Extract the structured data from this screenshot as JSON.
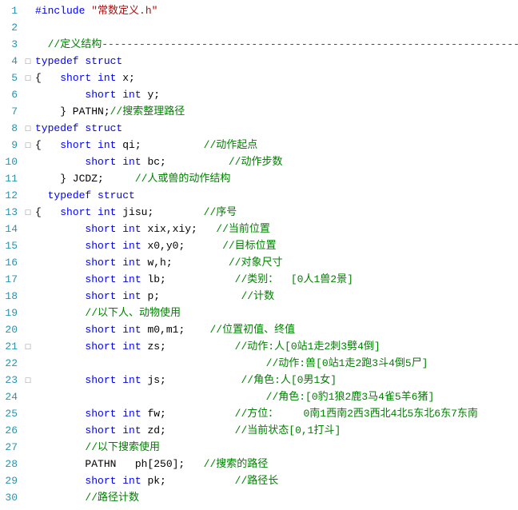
{
  "lines": [
    {
      "num": 1,
      "fold": "",
      "content": [
        {
          "type": "preproc",
          "text": "#include "
        },
        {
          "type": "string",
          "text": "\"常数定义.h\""
        }
      ]
    },
    {
      "num": 2,
      "fold": "",
      "content": []
    },
    {
      "num": 3,
      "fold": "",
      "content": [
        {
          "type": "comment",
          "text": "  //定义结构------------------------------------------------------------------------"
        }
      ]
    },
    {
      "num": 4,
      "fold": "□",
      "content": [
        {
          "type": "kw",
          "text": "typedef struct"
        }
      ]
    },
    {
      "num": 5,
      "fold": "□",
      "content": [
        {
          "type": "black",
          "text": "{   "
        },
        {
          "type": "kw",
          "text": "short int"
        },
        {
          "type": "black",
          "text": " x;"
        }
      ]
    },
    {
      "num": 6,
      "fold": "",
      "content": [
        {
          "type": "black",
          "text": "        "
        },
        {
          "type": "kw",
          "text": "short int"
        },
        {
          "type": "black",
          "text": " y;"
        }
      ]
    },
    {
      "num": 7,
      "fold": "",
      "content": [
        {
          "type": "black",
          "text": "    } PATHN;"
        },
        {
          "type": "comment",
          "text": "//搜索整理路径"
        }
      ]
    },
    {
      "num": 8,
      "fold": "□",
      "content": [
        {
          "type": "kw",
          "text": "typedef struct"
        }
      ]
    },
    {
      "num": 9,
      "fold": "□",
      "content": [
        {
          "type": "black",
          "text": "{   "
        },
        {
          "type": "kw",
          "text": "short int"
        },
        {
          "type": "black",
          "text": " qi;          "
        },
        {
          "type": "comment",
          "text": "//动作起点"
        }
      ]
    },
    {
      "num": 10,
      "fold": "",
      "content": [
        {
          "type": "black",
          "text": "        "
        },
        {
          "type": "kw",
          "text": "short int"
        },
        {
          "type": "black",
          "text": " bc;          "
        },
        {
          "type": "comment",
          "text": "//动作步数"
        }
      ]
    },
    {
      "num": 11,
      "fold": "",
      "content": [
        {
          "type": "black",
          "text": "    } JCDZ;     "
        },
        {
          "type": "comment",
          "text": "//人或兽的动作结构"
        }
      ]
    },
    {
      "num": 12,
      "fold": "",
      "content": [
        {
          "type": "black",
          "text": "  "
        },
        {
          "type": "kw",
          "text": "typedef struct"
        }
      ]
    },
    {
      "num": 13,
      "fold": "□",
      "content": [
        {
          "type": "black",
          "text": "{   "
        },
        {
          "type": "kw",
          "text": "short int"
        },
        {
          "type": "black",
          "text": " jisu;        "
        },
        {
          "type": "comment",
          "text": "//序号"
        }
      ]
    },
    {
      "num": 14,
      "fold": "",
      "content": [
        {
          "type": "black",
          "text": "        "
        },
        {
          "type": "kw",
          "text": "short int"
        },
        {
          "type": "black",
          "text": " xix,xiy;   "
        },
        {
          "type": "comment",
          "text": "//当前位置"
        }
      ]
    },
    {
      "num": 15,
      "fold": "",
      "content": [
        {
          "type": "black",
          "text": "        "
        },
        {
          "type": "kw",
          "text": "short int"
        },
        {
          "type": "black",
          "text": " x0,y0;      "
        },
        {
          "type": "comment",
          "text": "//目标位置"
        }
      ]
    },
    {
      "num": 16,
      "fold": "",
      "content": [
        {
          "type": "black",
          "text": "        "
        },
        {
          "type": "kw",
          "text": "short int"
        },
        {
          "type": "black",
          "text": " w,h;         "
        },
        {
          "type": "comment",
          "text": "//对象尺寸"
        }
      ]
    },
    {
      "num": 17,
      "fold": "",
      "content": [
        {
          "type": "black",
          "text": "        "
        },
        {
          "type": "kw",
          "text": "short int"
        },
        {
          "type": "black",
          "text": " lb;           "
        },
        {
          "type": "comment",
          "text": "//类别：  [0人1兽2景]"
        }
      ]
    },
    {
      "num": 18,
      "fold": "",
      "content": [
        {
          "type": "black",
          "text": "        "
        },
        {
          "type": "kw",
          "text": "short int"
        },
        {
          "type": "black",
          "text": " p;             "
        },
        {
          "type": "comment",
          "text": "//计数"
        }
      ]
    },
    {
      "num": 19,
      "fold": "",
      "content": [
        {
          "type": "black",
          "text": "        "
        },
        {
          "type": "comment",
          "text": "//以下人、动物使用"
        }
      ]
    },
    {
      "num": 20,
      "fold": "",
      "content": [
        {
          "type": "black",
          "text": "        "
        },
        {
          "type": "kw",
          "text": "short int"
        },
        {
          "type": "black",
          "text": " m0,m1;    "
        },
        {
          "type": "comment",
          "text": "//位置初值、终值"
        }
      ]
    },
    {
      "num": 21,
      "fold": "□",
      "content": [
        {
          "type": "black",
          "text": "        "
        },
        {
          "type": "kw",
          "text": "short int"
        },
        {
          "type": "black",
          "text": " zs;           "
        },
        {
          "type": "comment",
          "text": "//动作:人[0站1走2刺3劈4倒]"
        }
      ]
    },
    {
      "num": 22,
      "fold": "",
      "content": [
        {
          "type": "black",
          "text": "                                     "
        },
        {
          "type": "comment",
          "text": "//动作:兽[0站1走2跑3斗4倒5尸]"
        }
      ]
    },
    {
      "num": 23,
      "fold": "□",
      "content": [
        {
          "type": "black",
          "text": "        "
        },
        {
          "type": "kw",
          "text": "short int"
        },
        {
          "type": "black",
          "text": " js;            "
        },
        {
          "type": "comment",
          "text": "//角色:人[0男1女]"
        }
      ]
    },
    {
      "num": 24,
      "fold": "",
      "content": [
        {
          "type": "black",
          "text": "                                     "
        },
        {
          "type": "comment",
          "text": "//角色:[0豹1狼2鹿3马4雀5羊6猪]"
        }
      ]
    },
    {
      "num": 25,
      "fold": "",
      "content": [
        {
          "type": "black",
          "text": "        "
        },
        {
          "type": "kw",
          "text": "short int"
        },
        {
          "type": "black",
          "text": " fw;           "
        },
        {
          "type": "comment",
          "text": "//方位：    0南1西南2西3西北4北5东北6东7东南"
        }
      ]
    },
    {
      "num": 26,
      "fold": "",
      "content": [
        {
          "type": "black",
          "text": "        "
        },
        {
          "type": "kw",
          "text": "short int"
        },
        {
          "type": "black",
          "text": " zd;           "
        },
        {
          "type": "comment",
          "text": "//当前状态[0,1打斗]"
        }
      ]
    },
    {
      "num": 27,
      "fold": "",
      "content": [
        {
          "type": "black",
          "text": "        "
        },
        {
          "type": "comment",
          "text": "//以下搜索使用"
        }
      ]
    },
    {
      "num": 28,
      "fold": "",
      "content": [
        {
          "type": "black",
          "text": "        PATHN   ph[250];   "
        },
        {
          "type": "comment",
          "text": "//搜索的路径"
        }
      ]
    },
    {
      "num": 29,
      "fold": "",
      "content": [
        {
          "type": "black",
          "text": "        "
        },
        {
          "type": "kw",
          "text": "short int"
        },
        {
          "type": "black",
          "text": " pk;           "
        },
        {
          "type": "comment",
          "text": "//路径长"
        }
      ]
    },
    {
      "num": 30,
      "fold": "",
      "content": [
        {
          "type": "black",
          "text": "        "
        },
        {
          "type": "comment",
          "text": "//路径计数"
        }
      ]
    }
  ]
}
